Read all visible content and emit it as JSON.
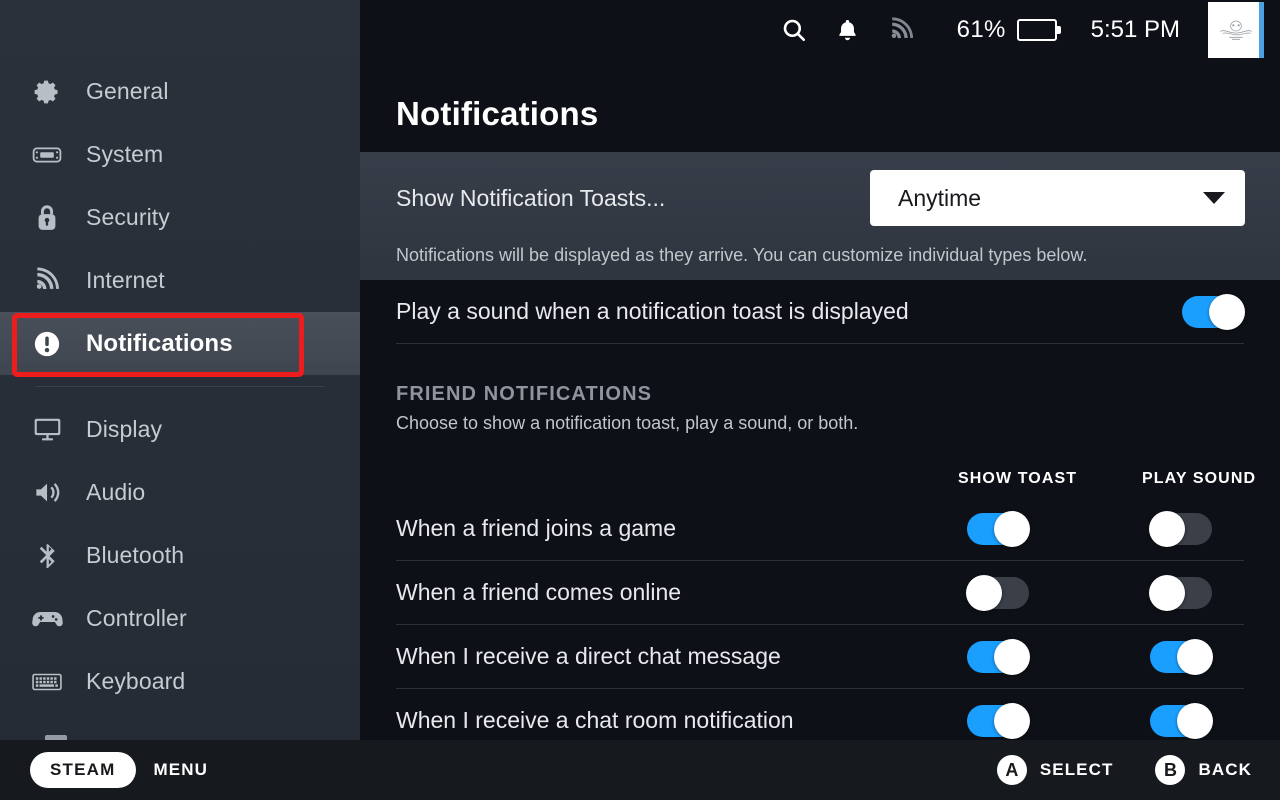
{
  "statusbar": {
    "search_icon": "search-icon",
    "bell_icon": "bell-icon",
    "wifi_icon": "wifi-icon",
    "battery_percent": "61%",
    "battery_level": 61,
    "time": "5:51 PM",
    "avatar": "user-avatar"
  },
  "sidebar": {
    "items": [
      {
        "label": "General",
        "icon": "gear-icon",
        "selected": false
      },
      {
        "label": "System",
        "icon": "handheld-icon",
        "selected": false
      },
      {
        "label": "Security",
        "icon": "lock-icon",
        "selected": false
      },
      {
        "label": "Internet",
        "icon": "wifi-icon",
        "selected": false
      },
      {
        "label": "Notifications",
        "icon": "alert-circle-icon",
        "selected": true
      },
      {
        "label": "Display",
        "icon": "monitor-icon",
        "selected": false
      },
      {
        "label": "Audio",
        "icon": "speaker-icon",
        "selected": false
      },
      {
        "label": "Bluetooth",
        "icon": "bluetooth-icon",
        "selected": false
      },
      {
        "label": "Controller",
        "icon": "gamepad-icon",
        "selected": false
      },
      {
        "label": "Keyboard",
        "icon": "keyboard-icon",
        "selected": false
      }
    ]
  },
  "main": {
    "title": "Notifications",
    "toast_setting": {
      "label": "Show Notification Toasts...",
      "value": "Anytime",
      "help": "Notifications will be displayed as they arrive. You can customize individual types below."
    },
    "sound_row": {
      "label": "Play a sound when a notification toast is displayed",
      "enabled": true
    },
    "friend_section": {
      "title": "FRIEND NOTIFICATIONS",
      "subtitle": "Choose to show a notification toast, play a sound, or both.",
      "col_toast": "SHOW TOAST",
      "col_sound": "PLAY SOUND",
      "rows": [
        {
          "label": "When a friend joins a game",
          "show_toast": true,
          "play_sound": false
        },
        {
          "label": "When a friend comes online",
          "show_toast": false,
          "play_sound": false
        },
        {
          "label": "When I receive a direct chat message",
          "show_toast": true,
          "play_sound": true
        },
        {
          "label": "When I receive a chat room notification",
          "show_toast": true,
          "play_sound": true
        }
      ]
    }
  },
  "footer": {
    "steam_label": "STEAM",
    "menu_label": "MENU",
    "select_glyph": "A",
    "select_label": "SELECT",
    "back_glyph": "B",
    "back_label": "BACK"
  },
  "colors": {
    "accent_blue": "#1a9fff",
    "battery_green": "#5cc523",
    "annotation_red": "#ee1d1d",
    "sidebar_bg": "#282e38",
    "content_bg": "#0d1117"
  }
}
